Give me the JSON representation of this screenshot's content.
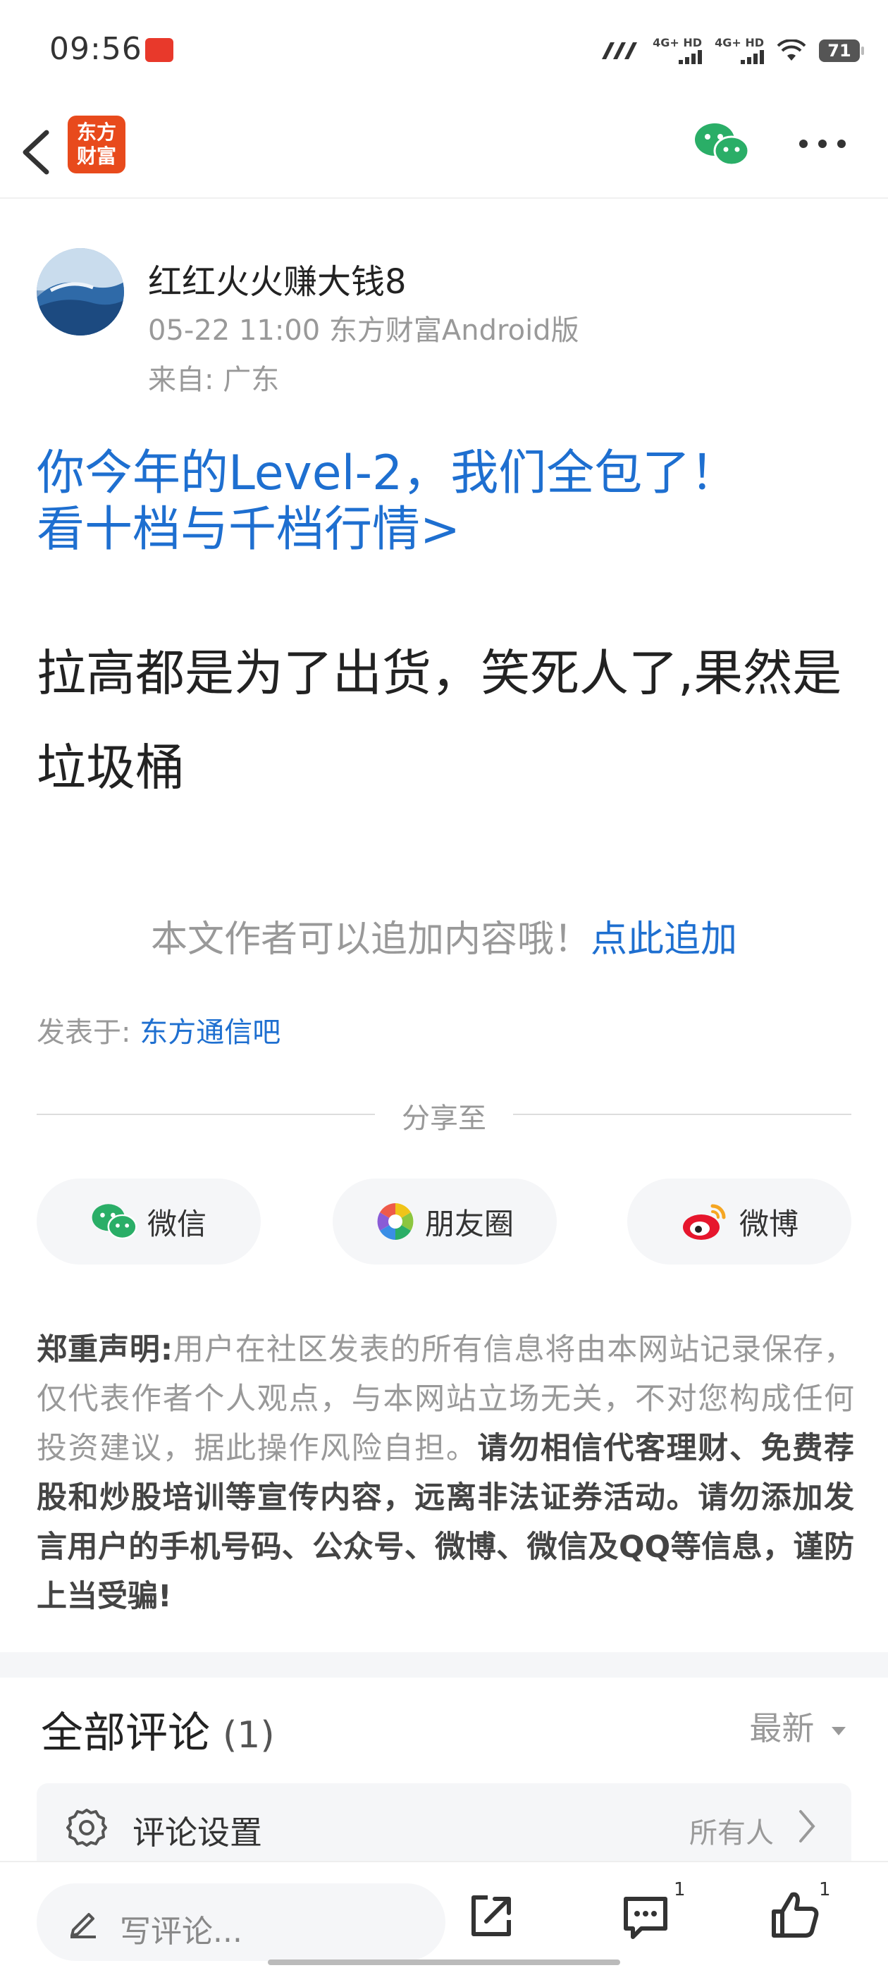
{
  "status_bar": {
    "time": "09:56",
    "network_1": "4G+ HD",
    "network_2": "4G+ HD",
    "battery": "71"
  },
  "header": {
    "brand_line1": "东方",
    "brand_line2": "财富"
  },
  "author": {
    "name": "红红火火赚大钱8",
    "meta": "05-22 11:00 东方财富Android版",
    "location": "来自: 广东"
  },
  "ad": {
    "line1": "你今年的Level-2，我们全包了！",
    "line2": "看十档与千档行情>"
  },
  "post": {
    "body": "拉高都是为了出货，笑死人了,果然是垃圾桶"
  },
  "append": {
    "text": "本文作者可以追加内容哦！",
    "link": "点此追加"
  },
  "posted_in": {
    "label": "发表于: ",
    "forum": "东方通信吧"
  },
  "share": {
    "title": "分享至",
    "wechat": "微信",
    "moments": "朋友圈",
    "weibo": "微博"
  },
  "disclaimer": {
    "title": "郑重声明:",
    "text": "用户在社区发表的所有信息将由本网站记录保存，仅代表作者个人观点，与本网站立场无关，不对您构成任何投资建议，据此操作风险自担。",
    "bold": "请勿相信代客理财、免费荐股和炒股培训等宣传内容，远离非法证券活动。请勿添加发言用户的手机号码、公众号、微博、微信及QQ等信息，谨防上当受骗!"
  },
  "comments": {
    "title": "全部评论",
    "count": "(1)",
    "sort": "最新",
    "settings_label": "评论设置",
    "settings_value": "所有人"
  },
  "bottom_bar": {
    "placeholder": "写评论...",
    "comment_badge": "1",
    "like_badge": "1"
  },
  "colors": {
    "link_blue": "#1e6fd0",
    "brand_orange": "#e84a1c",
    "wechat_green": "#2aae67"
  }
}
